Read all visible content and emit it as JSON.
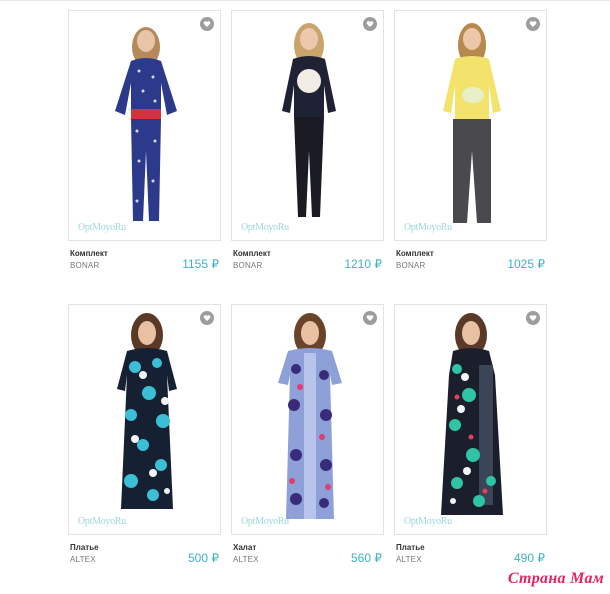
{
  "products": [
    {
      "title": "Комплект",
      "brand": "BONAR",
      "price": "1155 ₽",
      "watermark": "OptMoyoRu"
    },
    {
      "title": "Комплект",
      "brand": "BONAR",
      "price": "1210 ₽",
      "watermark": "OptMoyoRu"
    },
    {
      "title": "Комплект",
      "brand": "BONAR",
      "price": "1025 ₽",
      "watermark": "OptMoyoRu"
    },
    {
      "title": "Платье",
      "brand": "ALTEX",
      "price": "500 ₽",
      "watermark": "OptMoyoRu"
    },
    {
      "title": "Халат",
      "brand": "ALTEX",
      "price": "560 ₽",
      "watermark": "OptMoyoRu"
    },
    {
      "title": "Платье",
      "brand": "ALTEX",
      "price": "490 ₽",
      "watermark": "OptMoyoRu"
    }
  ],
  "site_logo": "Страна Мам",
  "colors": {
    "accent": "#3fb2c4",
    "logo": "#e3255e",
    "fav_icon": "#9d9d9d"
  },
  "icons": {
    "favorite": "heart-icon"
  }
}
